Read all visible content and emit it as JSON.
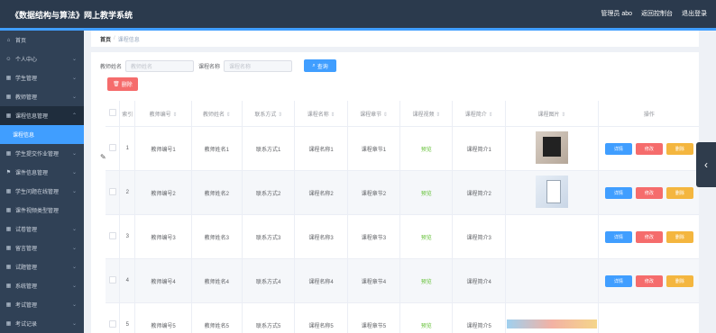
{
  "header": {
    "title": "《数据结构与算法》网上教学系统",
    "user_label": "管理员 abo",
    "admin_label": "返回控制台",
    "logout_label": "退出登录"
  },
  "sidebar": {
    "items": [
      {
        "label": "首页",
        "icon": "home-icon"
      },
      {
        "label": "个人中心",
        "icon": "user-icon"
      },
      {
        "label": "学生管理",
        "icon": "grid-icon"
      },
      {
        "label": "教师管理",
        "icon": "grid-icon"
      },
      {
        "label": "课程信息管理",
        "icon": "grid-icon"
      },
      {
        "label": "课程信息",
        "icon": ""
      },
      {
        "label": "学生提交作业管理",
        "icon": "grid-icon"
      },
      {
        "label": "课件信息管理",
        "icon": "flag-icon"
      },
      {
        "label": "学生问题在线管理",
        "icon": "grid-icon"
      },
      {
        "label": "课件视频类型管理",
        "icon": "grid-icon"
      },
      {
        "label": "试卷管理",
        "icon": "grid-icon"
      },
      {
        "label": "留言管理",
        "icon": "grid-icon"
      },
      {
        "label": "试题管理",
        "icon": "grid-icon"
      },
      {
        "label": "系统管理",
        "icon": "grid-icon"
      },
      {
        "label": "考试管理",
        "icon": "grid-icon"
      },
      {
        "label": "考试记录",
        "icon": "grid-icon"
      }
    ]
  },
  "breadcrumb": {
    "home": "首页",
    "sep": "/",
    "current": "课程信息"
  },
  "search": {
    "field1_label": "教师姓名",
    "field1_placeholder": "教师姓名",
    "field2_label": "课程名称",
    "field2_placeholder": "课程名称",
    "button": "查询"
  },
  "toolbar": {
    "delete_label": "删除"
  },
  "table": {
    "columns": [
      "",
      "索引",
      "教师编号",
      "教师姓名",
      "联系方式",
      "课程名称",
      "课程章节",
      "课程视频",
      "课程简介",
      "课程图片",
      "操作"
    ],
    "rows": [
      {
        "index": "1",
        "teacher_no": "教师编号1",
        "teacher_name": "教师姓名1",
        "contact": "联系方式1",
        "course": "课程名称1",
        "chapter": "课程章节1",
        "video": "预览",
        "intro": "课程简介1"
      },
      {
        "index": "2",
        "teacher_no": "教师编号2",
        "teacher_name": "教师姓名2",
        "contact": "联系方式2",
        "course": "课程名称2",
        "chapter": "课程章节2",
        "video": "预览",
        "intro": "课程简介2"
      },
      {
        "index": "3",
        "teacher_no": "教师编号3",
        "teacher_name": "教师姓名3",
        "contact": "联系方式3",
        "course": "课程名称3",
        "chapter": "课程章节3",
        "video": "预览",
        "intro": "课程简介3"
      },
      {
        "index": "4",
        "teacher_no": "教师编号4",
        "teacher_name": "教师姓名4",
        "contact": "联系方式4",
        "course": "课程名称4",
        "chapter": "课程章节4",
        "video": "预览",
        "intro": "课程简介4"
      },
      {
        "index": "5",
        "teacher_no": "教师编号5",
        "teacher_name": "教师姓名5",
        "contact": "联系方式5",
        "course": "课程名称5",
        "chapter": "课程章节5",
        "video": "预览",
        "intro": "课程简介5"
      }
    ],
    "actions": {
      "detail": "详情",
      "edit": "修改",
      "delete": "删除"
    }
  },
  "colors": {
    "primary": "#409eff",
    "danger": "#f56c6c",
    "warning": "#f4b63f",
    "sidebar": "#304156",
    "topbar": "#2b3a4d"
  }
}
